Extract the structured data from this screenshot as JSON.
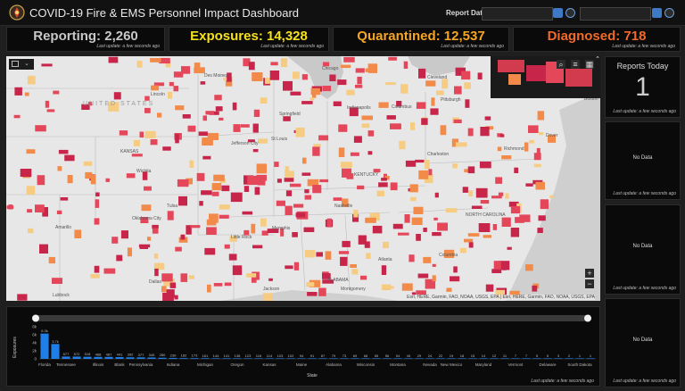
{
  "header": {
    "title": "COVID-19 Fire & EMS Personnel Impact Dashboard",
    "report_date_label": "Report Date"
  },
  "kpis": [
    {
      "text": "Reporting: 2,260",
      "color": "#c8c8c8",
      "update": "Last update: a few seconds ago"
    },
    {
      "text": "Exposures: 14,328",
      "color": "#f5e11b",
      "update": "Last update: a few seconds ago"
    },
    {
      "text": "Quarantined: 12,537",
      "color": "#f5a623",
      "update": "Last update: a few seconds ago"
    },
    {
      "text": "Diagnosed: 718",
      "color": "#f06a2a",
      "update": "Last update: a few seconds ago"
    }
  ],
  "reports_today": {
    "title": "Reports Today",
    "value": "1",
    "update": "Last update: a few seconds ago"
  },
  "side_panels": [
    {
      "text": "No Data",
      "update": "Last update: a few seconds ago"
    },
    {
      "text": "No Data",
      "update": "Last update: a few seconds ago"
    },
    {
      "text": "No Data",
      "update": "Last update: a few seconds ago"
    }
  ],
  "map": {
    "country_label": "UNITED STATES",
    "attribution": "Esri, HERE, Garmin, FAO, NOAA, USGS, EPA | Esri, HERE, Garmin, FAO, NOAA, USGS, EPA",
    "zoom_in": "+",
    "zoom_out": "−",
    "labels": [
      {
        "text": "Chicago",
        "x": 354,
        "y": 11
      },
      {
        "text": "Des Moines",
        "x": 222,
        "y": 19
      },
      {
        "text": "Cleveland",
        "x": 472,
        "y": 21
      },
      {
        "text": "Lincoln",
        "x": 162,
        "y": 40
      },
      {
        "text": "Indianapolis",
        "x": 382,
        "y": 55
      },
      {
        "text": "Columbus",
        "x": 432,
        "y": 54
      },
      {
        "text": "Pittsburgh",
        "x": 487,
        "y": 46
      },
      {
        "text": "Springfield",
        "x": 306,
        "y": 62
      },
      {
        "text": "KANSAS",
        "x": 128,
        "y": 104
      },
      {
        "text": "Wichita",
        "x": 146,
        "y": 126
      },
      {
        "text": "Jefferson City",
        "x": 252,
        "y": 95
      },
      {
        "text": "St Louis",
        "x": 297,
        "y": 90
      },
      {
        "text": "Charleston",
        "x": 472,
        "y": 107
      },
      {
        "text": "Richmond",
        "x": 558,
        "y": 101
      },
      {
        "text": "Dover",
        "x": 605,
        "y": 86
      },
      {
        "text": "KENTUCKY",
        "x": 390,
        "y": 130
      },
      {
        "text": "Oklahoma City",
        "x": 141,
        "y": 179
      },
      {
        "text": "Tulsa",
        "x": 180,
        "y": 165
      },
      {
        "text": "Memphis",
        "x": 298,
        "y": 190
      },
      {
        "text": "Nashville",
        "x": 368,
        "y": 165
      },
      {
        "text": "NORTH CAROLINA",
        "x": 515,
        "y": 175
      },
      {
        "text": "Little Rock",
        "x": 252,
        "y": 200
      },
      {
        "text": "Amarillo",
        "x": 55,
        "y": 189
      },
      {
        "text": "Atlanta",
        "x": 417,
        "y": 225
      },
      {
        "text": "Columbia",
        "x": 485,
        "y": 220
      },
      {
        "text": "Dallas",
        "x": 160,
        "y": 250
      },
      {
        "text": "Jackson",
        "x": 288,
        "y": 258
      },
      {
        "text": "Montgomery",
        "x": 375,
        "y": 258
      },
      {
        "text": "ALABAMA",
        "x": 360,
        "y": 248
      },
      {
        "text": "Boston",
        "x": 648,
        "y": 45
      },
      {
        "text": "Lubbock",
        "x": 52,
        "y": 265
      }
    ]
  },
  "chart_data": {
    "type": "bar",
    "xlabel": "State",
    "ylabel": "Exposures",
    "ylim": [
      0,
      8000
    ],
    "yticks": [
      "8k",
      "6k",
      "4k",
      "2k",
      "0"
    ],
    "bar_color": "#1e7fe8",
    "categories": [
      "Florida",
      "",
      "Tennessee",
      "",
      "",
      "Illinois",
      "",
      "Blank",
      "",
      "Pennsylvania",
      "",
      "",
      "Indiana",
      "",
      "",
      "Michigan",
      "",
      "",
      "Oregon",
      "",
      "",
      "Kansas",
      "",
      "",
      "Maine",
      "",
      "",
      "Alabama",
      "",
      "",
      "Wisconsin",
      "",
      "",
      "Montana",
      "",
      "",
      "Nevada",
      "",
      "New Mexico",
      "",
      "",
      "Maryland",
      "",
      "",
      "Vermont",
      "",
      "",
      "Delaware",
      "",
      "",
      "South Dakota"
    ],
    "values": [
      6300,
      3700,
      577,
      572,
      518,
      488,
      487,
      441,
      392,
      377,
      345,
      280,
      230,
      182,
      173,
      161,
      144,
      141,
      138,
      123,
      116,
      114,
      103,
      102,
      94,
      91,
      87,
      79,
      73,
      69,
      68,
      65,
      56,
      54,
      45,
      29,
      24,
      22,
      19,
      18,
      15,
      14,
      12,
      11,
      7,
      7,
      5,
      5,
      3,
      2,
      1,
      1
    ],
    "data_labels": [
      "6.3k",
      "3.7k",
      "577",
      "572",
      "518",
      "488",
      "487",
      "441",
      "392",
      "377",
      "345",
      "280",
      "230",
      "182",
      "173",
      "161",
      "144",
      "141",
      "138",
      "123",
      "116",
      "114",
      "103",
      "102",
      "94",
      "91",
      "87",
      "79",
      "73",
      "69",
      "68",
      "65",
      "56",
      "54",
      "45",
      "29",
      "24",
      "22",
      "19",
      "18",
      "15",
      "14",
      "12",
      "11",
      "7",
      "7",
      "5",
      "5",
      "3",
      "2",
      "1",
      "1"
    ],
    "update": "Last update: a few seconds ago"
  },
  "colors": {
    "fill_high": "#c8254a",
    "fill_mid": "#e4465a",
    "fill_orange": "#f28a4a",
    "fill_low": "#f6cc82"
  }
}
